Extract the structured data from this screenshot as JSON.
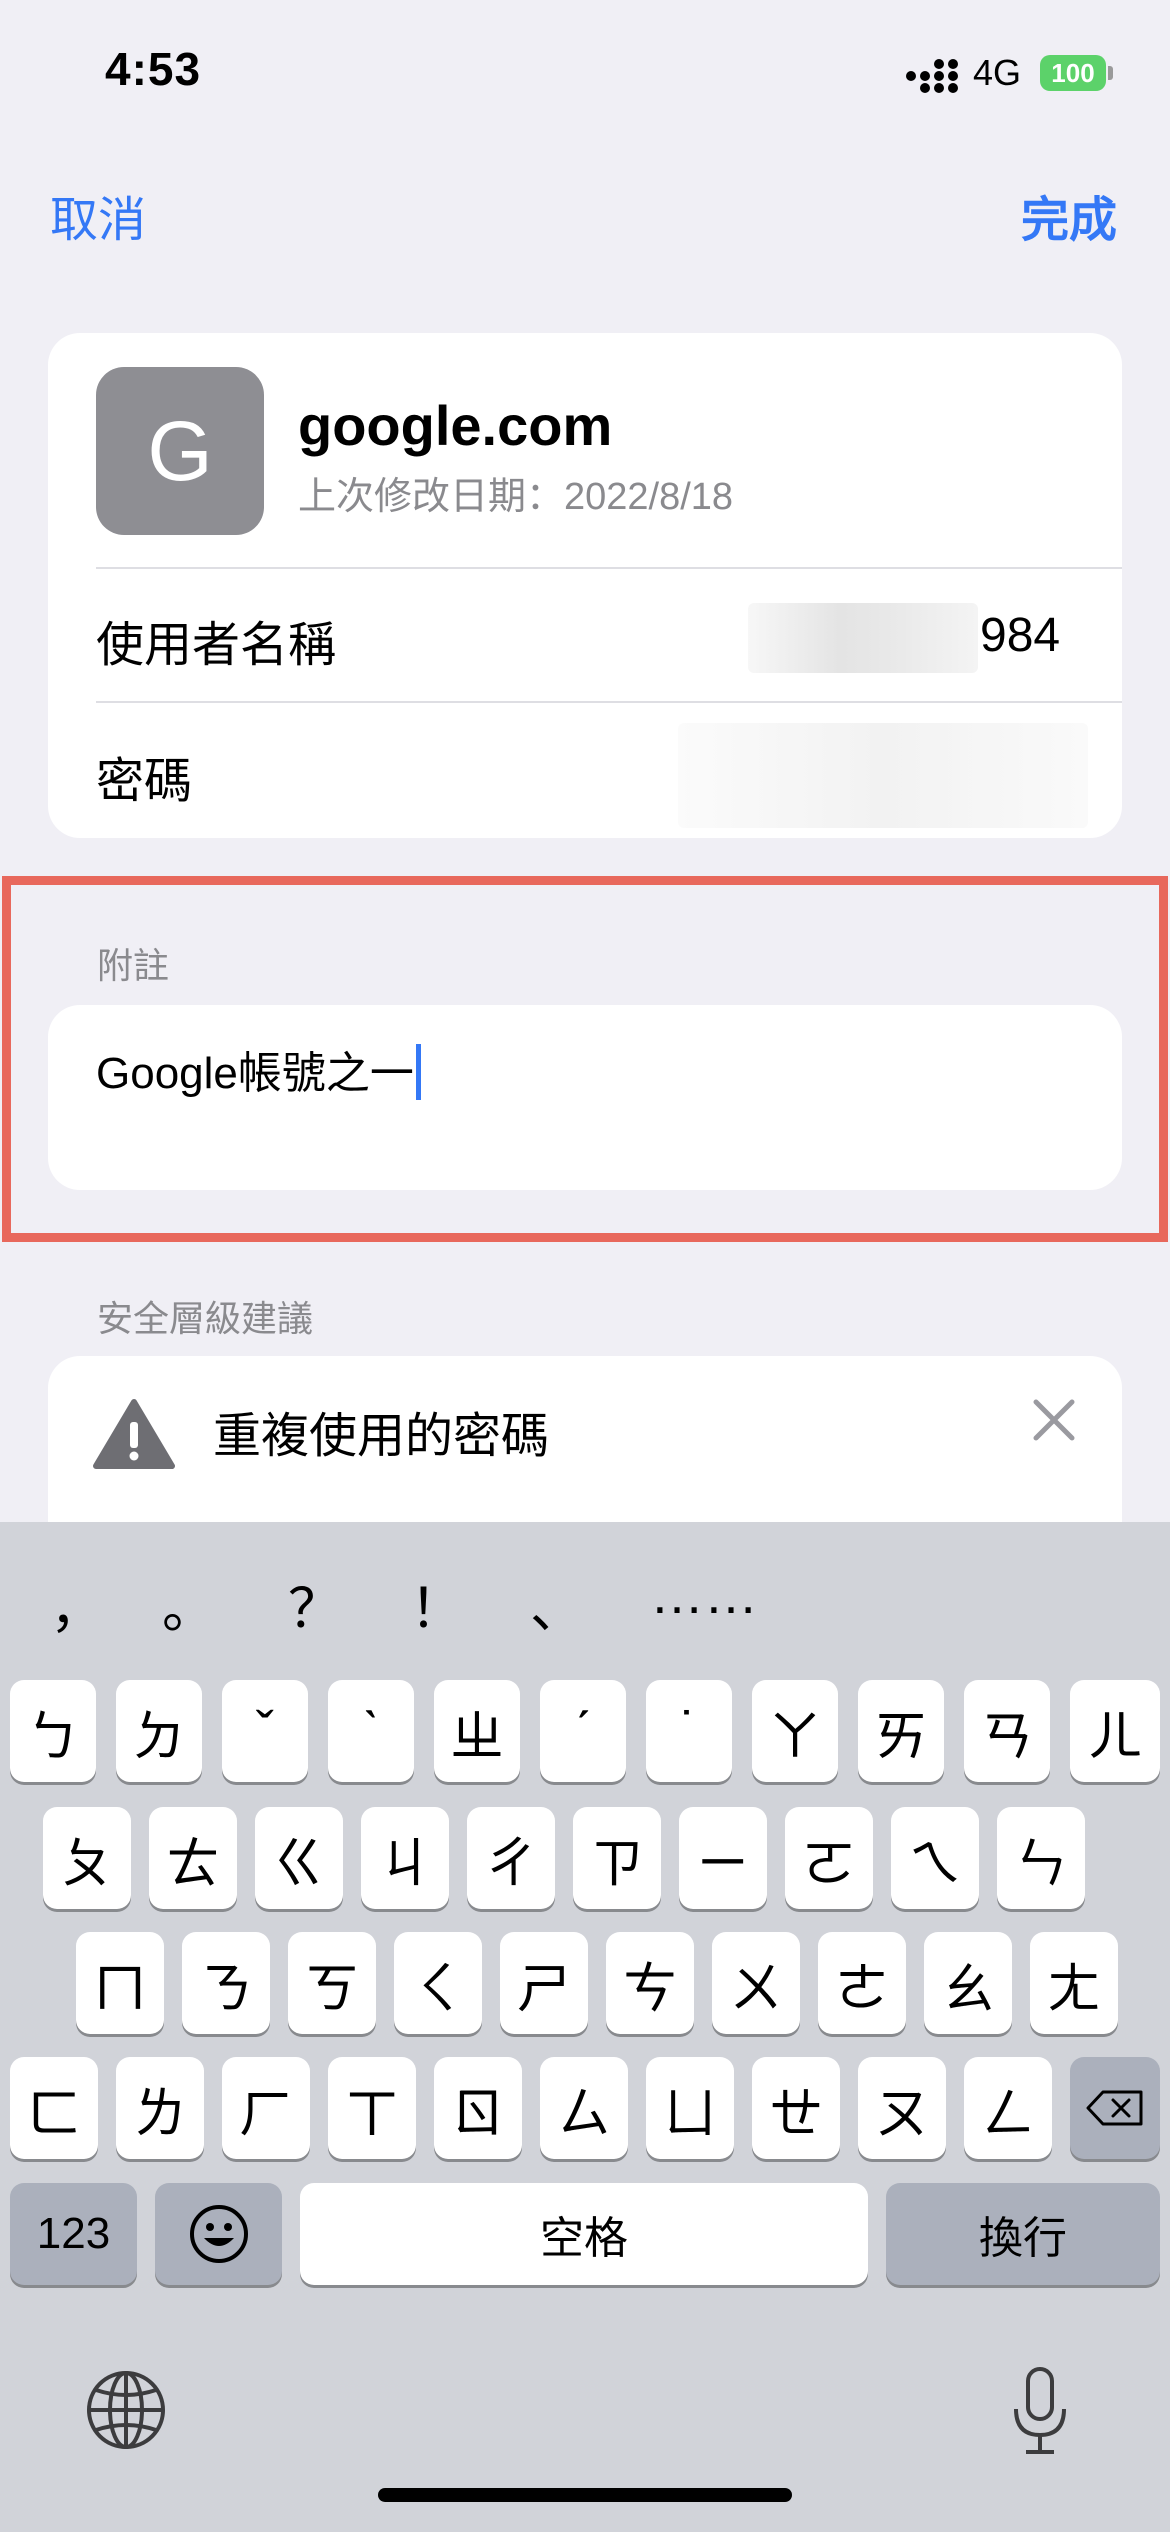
{
  "status": {
    "time": "4:53",
    "network": "4G",
    "battery": "100"
  },
  "nav": {
    "cancel": "取消",
    "done": "完成"
  },
  "account": {
    "initial": "G",
    "domain": "google.com",
    "modified": "上次修改日期：2022/8/18",
    "username_label": "使用者名稱",
    "username_tail": "984",
    "password_label": "密碼"
  },
  "notes": {
    "header": "附註",
    "text": "Google帳號之一"
  },
  "security": {
    "header": "安全層級建議",
    "title": "重複使用的密碼"
  },
  "keyboard": {
    "candidates": [
      "，",
      "。",
      "？",
      "！",
      "、",
      "……"
    ],
    "row1": [
      "ㄅ",
      "ㄉ",
      "ˇ",
      "ˋ",
      "ㄓ",
      "ˊ",
      "˙",
      "ㄚ",
      "ㄞ",
      "ㄢ",
      "ㄦ"
    ],
    "row2": [
      "ㄆ",
      "ㄊ",
      "ㄍ",
      "ㄐ",
      "ㄔ",
      "ㄗ",
      "ㄧ",
      "ㄛ",
      "ㄟ",
      "ㄣ"
    ],
    "row3": [
      "ㄇ",
      "ㄋ",
      "ㄎ",
      "ㄑ",
      "ㄕ",
      "ㄘ",
      "ㄨ",
      "ㄜ",
      "ㄠ",
      "ㄤ"
    ],
    "row4": [
      "ㄈ",
      "ㄌ",
      "ㄏ",
      "ㄒ",
      "ㄖ",
      "ㄙ",
      "ㄩ",
      "ㄝ",
      "ㄡ",
      "ㄥ"
    ],
    "numbers": "123",
    "space": "空格",
    "return": "換行"
  },
  "colors": {
    "accent": "#3478f6",
    "highlight": "#e8685c",
    "battery": "#5cd26a"
  }
}
